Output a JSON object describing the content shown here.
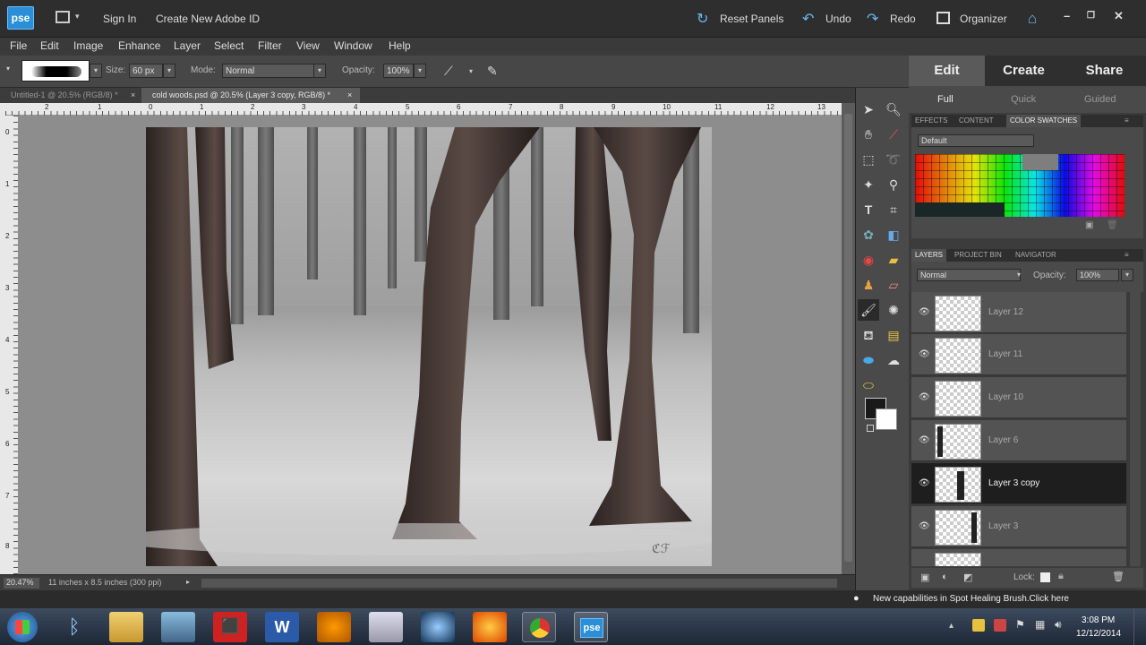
{
  "app": {
    "logo_text": "pse"
  },
  "titlebar": {
    "sign_in": "Sign In",
    "create_id": "Create New Adobe ID",
    "reset_panels": "Reset Panels",
    "undo": "Undo",
    "redo": "Redo",
    "organizer": "Organizer"
  },
  "menu": [
    "File",
    "Edit",
    "Image",
    "Enhance",
    "Layer",
    "Select",
    "Filter",
    "View",
    "Window",
    "Help"
  ],
  "options": {
    "size_label": "Size:",
    "size_value": "60 px",
    "mode_label": "Mode:",
    "mode_value": "Normal",
    "opacity_label": "Opacity:",
    "opacity_value": "100%"
  },
  "documents": [
    {
      "label": "Untitled-1 @ 20.5% (RGB/8) *",
      "active": false
    },
    {
      "label": "cold woods.psd @ 20.5% (Layer 3 copy, RGB/8) *",
      "active": true
    }
  ],
  "rulers": {
    "top": [
      "2",
      "1",
      "0",
      "1",
      "2",
      "3",
      "4",
      "5",
      "6",
      "7",
      "8",
      "9",
      "10",
      "11",
      "12",
      "13"
    ],
    "left": [
      "0",
      "1",
      "2",
      "3",
      "4",
      "5",
      "6",
      "7",
      "8"
    ]
  },
  "status": {
    "zoom": "20.47%",
    "doc_info": "11 inches x 8.5 inches (300 ppi)"
  },
  "panel": {
    "mode_tabs": [
      "Edit",
      "Create",
      "Share"
    ],
    "edit_subtabs": [
      "Full",
      "Quick",
      "Guided"
    ],
    "palette_tabs": [
      "EFFECTS",
      "CONTENT",
      "COLOR SWATCHES"
    ],
    "swatch_set": "Default",
    "layer_tabs": [
      "LAYERS",
      "PROJECT BIN",
      "NAVIGATOR"
    ],
    "blend_mode": "Normal",
    "opacity_label": "Opacity:",
    "opacity_value": "100%",
    "lock_label": "Lock:",
    "layers": [
      {
        "name": "Layer 12",
        "selected": false
      },
      {
        "name": "Layer 11",
        "selected": false
      },
      {
        "name": "Layer 10",
        "selected": false
      },
      {
        "name": "Layer 6",
        "selected": false
      },
      {
        "name": "Layer 3 copy",
        "selected": true
      },
      {
        "name": "Layer 3",
        "selected": false
      }
    ]
  },
  "notification": "New capabilities in Spot Healing Brush.Click here",
  "taskbar": {
    "time": "3:08 PM",
    "date": "12/12/2014",
    "app_label": "pse"
  }
}
